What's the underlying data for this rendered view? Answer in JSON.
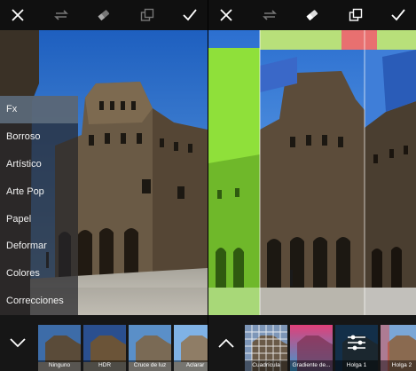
{
  "left_screen": {
    "toolbar": {
      "close_icon": "close-icon",
      "swap_icon": "swap-icon",
      "eraser_icon": "eraser-icon",
      "layers_icon": "layers-icon",
      "confirm_icon": "check-icon"
    },
    "menu": {
      "items": [
        {
          "label": "Fx",
          "active": true
        },
        {
          "label": "Borroso"
        },
        {
          "label": "Artístico"
        },
        {
          "label": "Arte Pop"
        },
        {
          "label": "Papel"
        },
        {
          "label": "Deformar"
        },
        {
          "label": "Colores"
        },
        {
          "label": "Correcciones"
        }
      ]
    },
    "effects": [
      {
        "label": "Ninguno",
        "selected": true
      },
      {
        "label": "HDR"
      },
      {
        "label": "Cruce de luz"
      },
      {
        "label": "Aclarar"
      }
    ],
    "collapse_icon": "chevron-down-icon"
  },
  "right_screen": {
    "toolbar": {
      "close_icon": "close-icon",
      "swap_icon": "swap-icon",
      "eraser_icon": "eraser-icon",
      "layers_icon": "layers-icon",
      "confirm_icon": "check-icon"
    },
    "effects": [
      {
        "label": "Cuadrícula"
      },
      {
        "label": "Gradiente de..."
      },
      {
        "label": "Holga 1",
        "selected": true
      },
      {
        "label": "Holga 2"
      }
    ],
    "expand_icon": "chevron-up-icon",
    "settings_icon": "sliders-icon"
  },
  "colors": {
    "toolbar_bg": "#101010",
    "menu_active": "#607080",
    "selection_accent": "#2f86c5"
  }
}
